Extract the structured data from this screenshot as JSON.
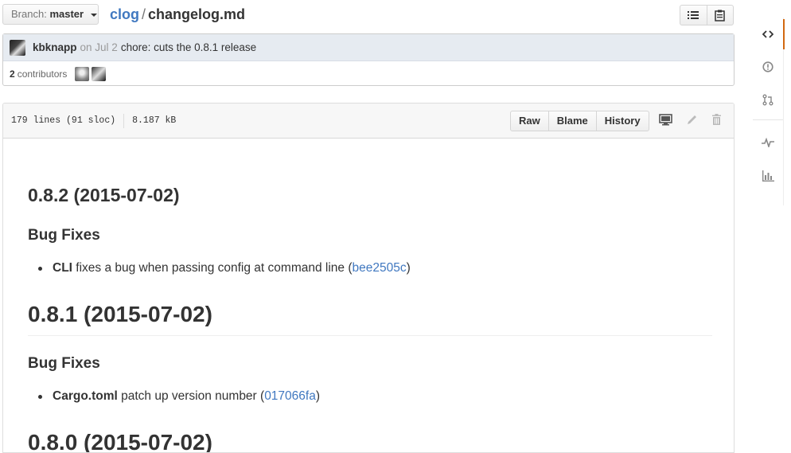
{
  "branch": {
    "prefix": "Branch:",
    "name": "master"
  },
  "path": {
    "repo": "clog",
    "separator": "/",
    "file": "changelog.md"
  },
  "commit": {
    "author": "kbknapp",
    "date": "on Jul 2",
    "message": "chore: cuts the 0.8.1 release",
    "contributors_count": "2",
    "contributors_label": "contributors"
  },
  "file": {
    "lines": "179 lines (91 sloc)",
    "size": "8.187 kB",
    "buttons": {
      "raw": "Raw",
      "blame": "Blame",
      "history": "History"
    }
  },
  "content": {
    "h_082": "0.8.2 (2015-07-02)",
    "bugfix_1": "Bug Fixes",
    "item1_bold": "CLI",
    "item1_text": " fixes a bug when passing config at command line (",
    "item1_link": "bee2505c",
    "item1_close": ")",
    "h_081": "0.8.1 (2015-07-02)",
    "bugfix_2": "Bug Fixes",
    "item2_bold": "Cargo.toml",
    "item2_text": " patch up version number (",
    "item2_link": "017066fa",
    "item2_close": ")",
    "h_080": "0.8.0 (2015-07-02)"
  },
  "colors": {
    "link": "#4078c0",
    "active_tab": "#d26911",
    "commit_bg": "#e6ebf1"
  },
  "icons": {
    "file_nav": [
      "list-icon",
      "clipboard-icon"
    ],
    "toolbar": [
      "desktop-icon",
      "pencil-icon",
      "trash-icon"
    ],
    "sidebar": [
      "code-icon",
      "issue-icon",
      "pull-request-icon",
      "pulse-icon",
      "graphs-icon"
    ]
  }
}
